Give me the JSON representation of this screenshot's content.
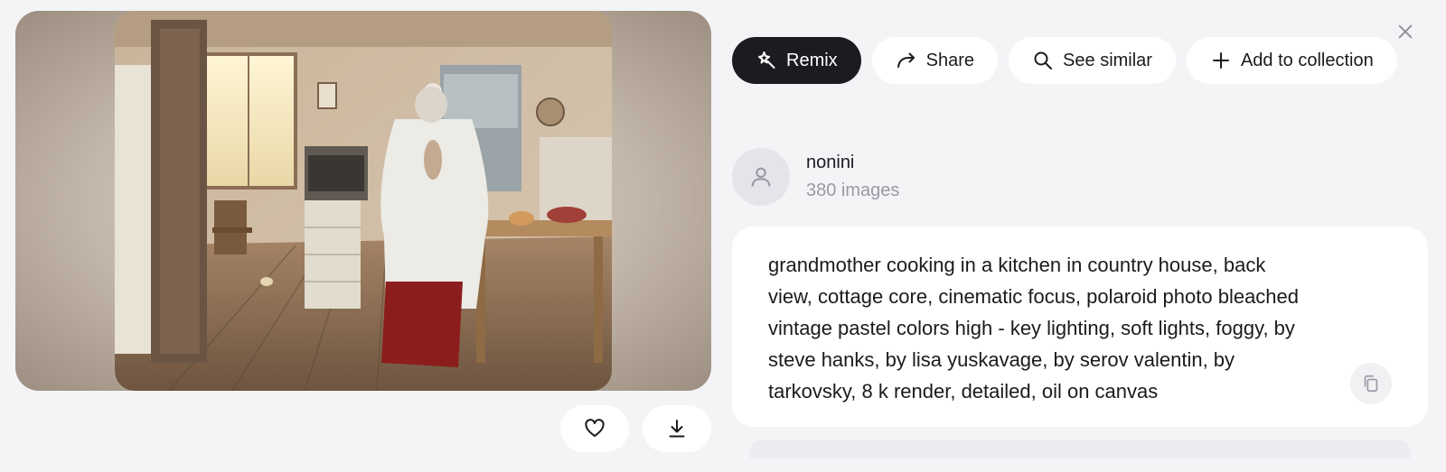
{
  "actions": {
    "remix_label": "Remix",
    "share_label": "Share",
    "see_similar_label": "See similar",
    "add_to_collection_label": "Add to collection"
  },
  "creator": {
    "name": "nonini",
    "image_count": "380 images"
  },
  "prompt": {
    "text": "grandmother cooking in a kitchen in country house, back view, cottage core, cinematic focus, polaroid photo bleached vintage pastel colors high - key lighting, soft lights, foggy, by steve hanks, by lisa yuskavage, by serov valentin, by tarkovsky, 8 k render, detailed, oil on canvas"
  },
  "icons": {
    "remix": "magic-wand-icon",
    "share": "share-arrow-icon",
    "see_similar": "search-icon",
    "add_to_collection": "plus-icon",
    "close": "close-icon",
    "like": "heart-icon",
    "download": "download-icon",
    "copy": "copy-icon",
    "avatar": "user-icon"
  },
  "colors": {
    "background": "#f4f4f7",
    "primary_button": "#1b1c22",
    "muted_text": "#9a9aa6"
  }
}
